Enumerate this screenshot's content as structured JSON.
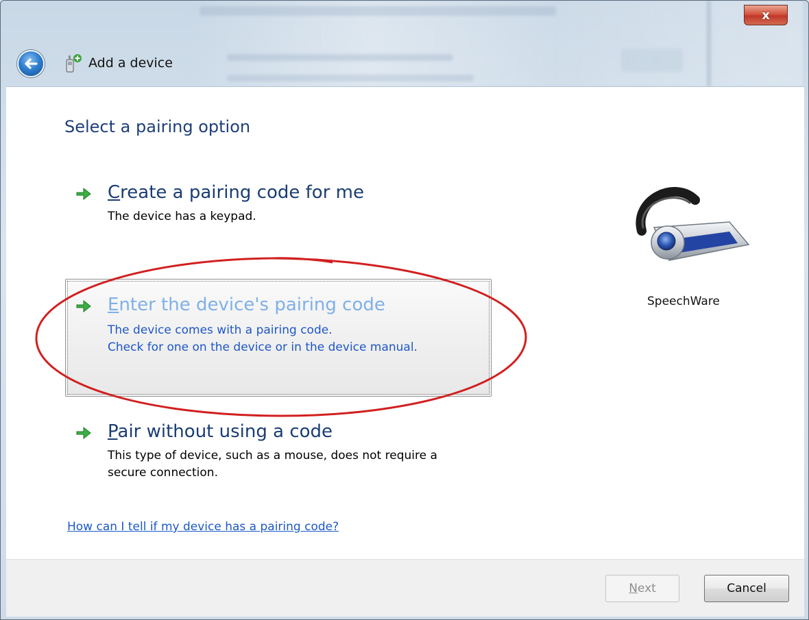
{
  "window": {
    "title": "Add a device",
    "close_label": "x"
  },
  "heading": "Select a pairing option",
  "options": [
    {
      "mnemonic": "C",
      "title_rest": "reate a pairing code for me",
      "description": [
        "The device has a keypad."
      ]
    },
    {
      "mnemonic": "E",
      "title_rest": "nter the device's pairing code",
      "description": [
        "The device comes with a pairing code.",
        "Check for one on the device or in the device manual."
      ]
    },
    {
      "mnemonic": "P",
      "title_rest": "air without using a code",
      "description": [
        "This type of device, such as a mouse, does not require a",
        "secure connection."
      ]
    }
  ],
  "help_link": "How can I tell if my device has a pairing code?",
  "device": {
    "name": "SpeechWare",
    "icon": "bluetooth-headset-icon"
  },
  "buttons": {
    "next_mnemonic": "N",
    "next_rest": "ext",
    "cancel": "Cancel"
  },
  "colors": {
    "heading": "#1e3f7a",
    "link": "#1a58c9",
    "highlight_ellipse": "#d21f1f"
  }
}
